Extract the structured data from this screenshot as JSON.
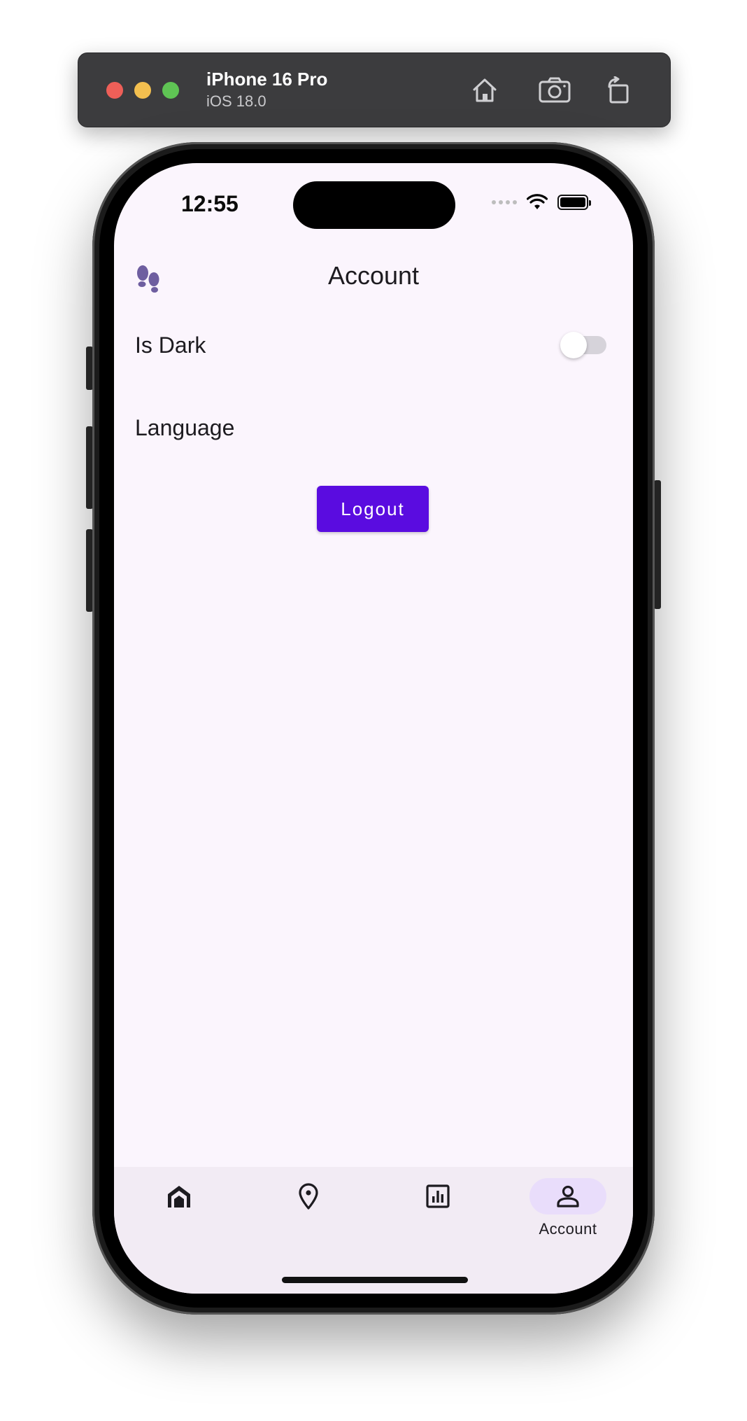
{
  "simulator": {
    "device_name": "iPhone 16 Pro",
    "os_version": "iOS 18.0",
    "buttons": [
      {
        "icon": "home-icon"
      },
      {
        "icon": "screenshot-icon"
      },
      {
        "icon": "rotate-icon"
      }
    ]
  },
  "status_bar": {
    "time": "12:55"
  },
  "app_bar": {
    "logo_icon": "footprints-icon",
    "title": "Account"
  },
  "settings": {
    "is_dark_label": "Is Dark",
    "is_dark_value": false,
    "language_label": "Language"
  },
  "logout_label": "Logout",
  "bottom_nav": {
    "items": [
      {
        "icon": "home-icon",
        "label": "",
        "active": false
      },
      {
        "icon": "location-pin-icon",
        "label": "",
        "active": false
      },
      {
        "icon": "chart-icon",
        "label": "",
        "active": false
      },
      {
        "icon": "person-icon",
        "label": "Account",
        "active": true
      }
    ]
  },
  "colors": {
    "accent": "#5a0ce0",
    "screen_background": "#fbf5fd",
    "nav_background": "#f2ebf4",
    "active_indicator": "#e9ddfb",
    "logo": "#6e5ea0"
  }
}
